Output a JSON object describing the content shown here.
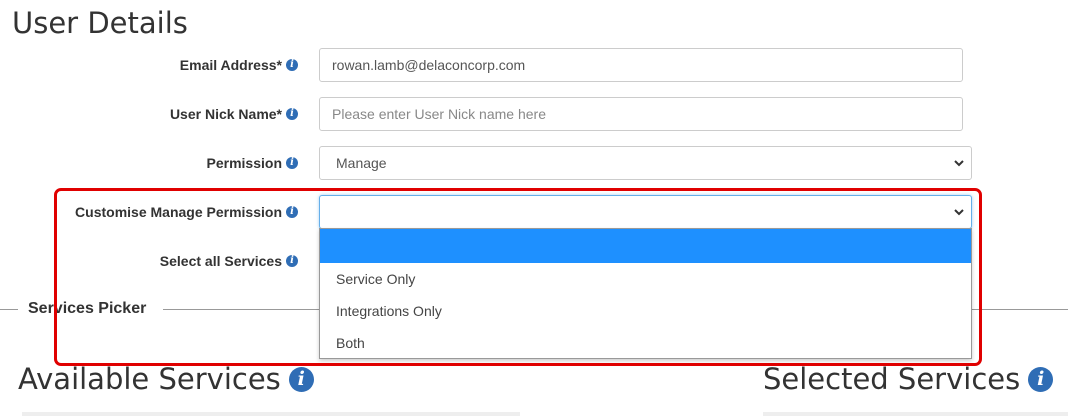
{
  "page": {
    "title": "User Details"
  },
  "form": {
    "email": {
      "label": "Email Address*",
      "value": "rowan.lamb@delaconcorp.com"
    },
    "nickname": {
      "label": "User Nick Name*",
      "placeholder": "Please enter User Nick name here"
    },
    "permission": {
      "label": "Permission",
      "selected": "Manage"
    },
    "custom_permission": {
      "label": "Customise Manage Permission",
      "selected": "",
      "options": [
        "",
        "Service Only",
        "Integrations Only",
        "Both"
      ]
    },
    "select_all_services": {
      "label": "Select all Services"
    }
  },
  "services_picker": {
    "legend": "Services Picker",
    "available_title": "Available Services",
    "selected_title": "Selected Services"
  },
  "icons": {
    "info": "info-icon",
    "dropdown": "chevron-down-icon"
  },
  "colors": {
    "highlight": "#e00000",
    "option_selected": "#1e90ff",
    "info_icon": "#2f6db5"
  }
}
